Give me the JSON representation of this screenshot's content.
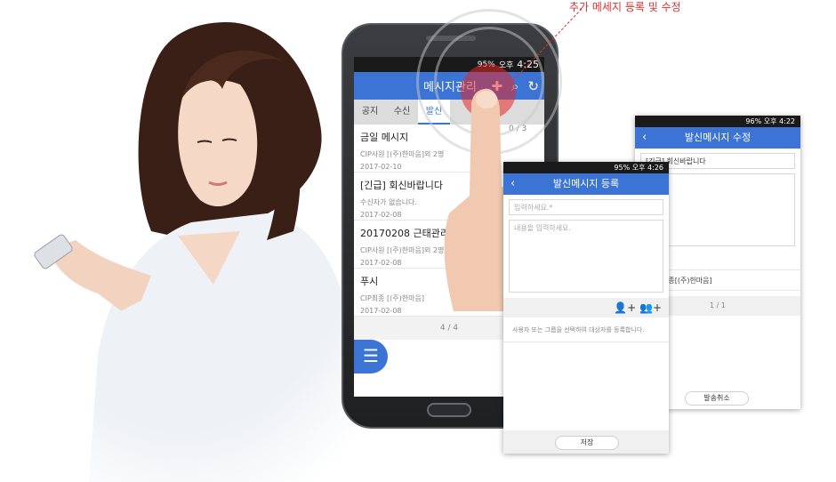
{
  "annotation": "추가 메세지 등록 및 수정",
  "phone": {
    "status": {
      "battery": "95%",
      "ampm": "오후",
      "time": "4:25"
    },
    "title": "메시지관리",
    "tabs": [
      "공지",
      "수신",
      "발신"
    ],
    "count": "0 / 3",
    "messages": [
      {
        "title": "금일 메시지",
        "sub": "CIP사원 [(주)한마음]외 2명",
        "date": "2017-02-10"
      },
      {
        "title": "[긴급] 회신바랍니다",
        "sub": "수신자가 없습니다.",
        "date": "2017-02-08"
      },
      {
        "title": "20170208 근태관리",
        "sub": "CIP사원 [(주)한마음]외 2명",
        "date": "2017-02-08"
      },
      {
        "title": "푸시",
        "sub": "CIP최종 [(주)한마음]",
        "date": "2017-02-08"
      }
    ],
    "pager": "4 / 4"
  },
  "register": {
    "status": {
      "battery": "95%",
      "ampm": "오후",
      "time": "4:26"
    },
    "title": "발신메시지 등록",
    "title_placeholder": "입력하세요.*",
    "body_placeholder": "내용을 입력하세요.",
    "hint": "사용자 또는 그룹을 선택하여 대상자를 등록합니다.",
    "save": "저장"
  },
  "edit": {
    "status": {
      "battery": "96%",
      "ampm": "오후",
      "time": "4:22"
    },
    "title": "발신메시지 수정",
    "subject": "[긴급] 회신바랍니다",
    "body": "니다",
    "recipient": "최종[(주)한마음]",
    "pager": "1 / 1",
    "cancel": "발송취소"
  }
}
